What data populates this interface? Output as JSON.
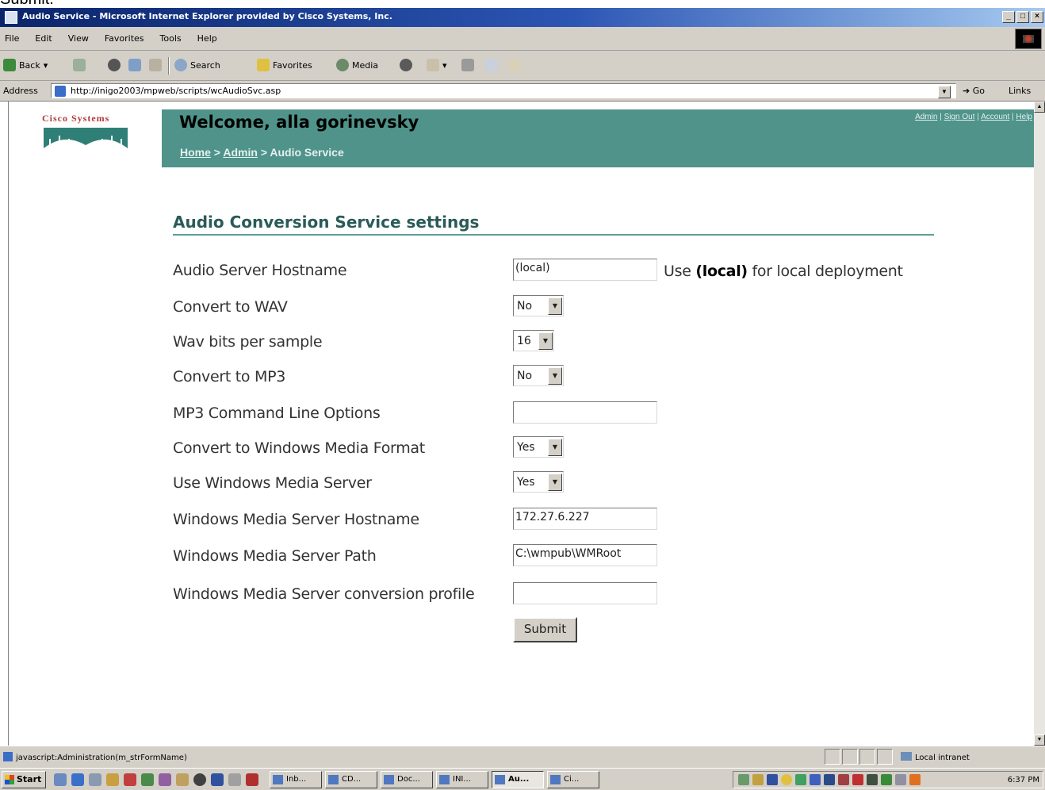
{
  "caption": "Submit.",
  "window": {
    "title": "Audio Service - Microsoft Internet Explorer provided by Cisco Systems, Inc.",
    "controls": [
      "_",
      "□",
      "×"
    ]
  },
  "menu": [
    "File",
    "Edit",
    "View",
    "Favorites",
    "Tools",
    "Help"
  ],
  "toolbar": {
    "back": "Back",
    "search": "Search",
    "favorites": "Favorites",
    "media": "Media"
  },
  "address": {
    "label": "Address",
    "url": "http://inigo2003/mpweb/scripts/wcAudioSvc.asp",
    "go": "Go",
    "links": "Links"
  },
  "page": {
    "logo": "Cisco Systems",
    "welcome": "Welcome, alla gorinevsky",
    "breadcrumb": [
      "Home",
      "Admin",
      "Audio Service"
    ],
    "breadcrumb_sep": ">",
    "top_links": [
      "Admin",
      "Sign Out",
      "Account",
      "Help"
    ],
    "section_title": "Audio Conversion Service settings",
    "fields": [
      {
        "label": "Audio Server Hostname",
        "type": "text",
        "value": "(local)"
      },
      {
        "label": "Convert to WAV",
        "type": "select",
        "value": "No"
      },
      {
        "label": "Wav bits per sample",
        "type": "select",
        "value": "16"
      },
      {
        "label": "Convert to MP3",
        "type": "select",
        "value": "No"
      },
      {
        "label": "MP3 Command Line Options",
        "type": "text",
        "value": ""
      },
      {
        "label": "Convert to Windows Media Format",
        "type": "select",
        "value": "Yes"
      },
      {
        "label": "Use Windows Media Server",
        "type": "select",
        "value": "Yes"
      },
      {
        "label": "Windows Media Server Hostname",
        "type": "text",
        "value": "172.27.6.227"
      },
      {
        "label": "Windows Media Server Path",
        "type": "text",
        "value": "C:\\wmpub\\WMRoot"
      },
      {
        "label": "Windows Media Server conversion profile",
        "type": "text",
        "value": ""
      }
    ],
    "hostname_hint_pre": "Use",
    "hostname_hint_bold": "(local)",
    "hostname_hint_post": "for local deployment",
    "submit": "Submit"
  },
  "status": {
    "message": "javascript:Administration(m_strFormName)",
    "zone": "Local intranet"
  },
  "taskbar": {
    "start": "Start",
    "tasks": [
      "Inb...",
      "CD...",
      "Doc...",
      "INI...",
      "Au...",
      "Ci..."
    ],
    "clock": "6:37 PM"
  },
  "colors": {
    "banner": "#4f938a",
    "section_title": "#2a5b57",
    "logo_red": "#b03b3b"
  }
}
